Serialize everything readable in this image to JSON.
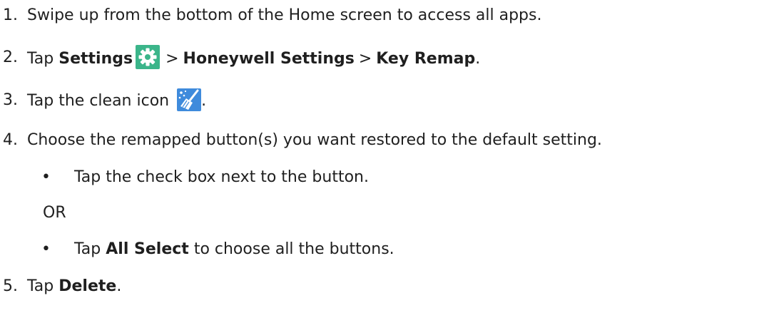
{
  "steps": [
    {
      "number": "1.",
      "text": "Swipe up from the bottom of the Home screen to access all apps."
    },
    {
      "number": "2.",
      "prefix": "Tap",
      "bold1": "Settings",
      "sep1": ">",
      "bold2": "Honeywell Settings",
      "sep2": ">",
      "bold3": "Key Remap",
      "suffix": ".",
      "icon": "settings-gear-icon"
    },
    {
      "number": "3.",
      "text": "Tap the clean icon",
      "suffix": ".",
      "icon": "clean-broom-icon"
    },
    {
      "number": "4.",
      "text": "Choose the remapped button(s) you want restored to the default setting."
    },
    {
      "number": "5.",
      "prefix": "Tap",
      "bold": "Delete",
      "suffix": "."
    }
  ],
  "substeps": {
    "bullet_char": "•",
    "item1": "Tap the check box next to the button.",
    "or_text": "OR",
    "item2_prefix": "Tap",
    "item2_bold": "All Select",
    "item2_suffix": "to choose all the buttons."
  },
  "colors": {
    "settings_icon_bg": "#3bb58a",
    "clean_icon_bg": "#3f8bdc",
    "text": "#1f1f1f"
  }
}
